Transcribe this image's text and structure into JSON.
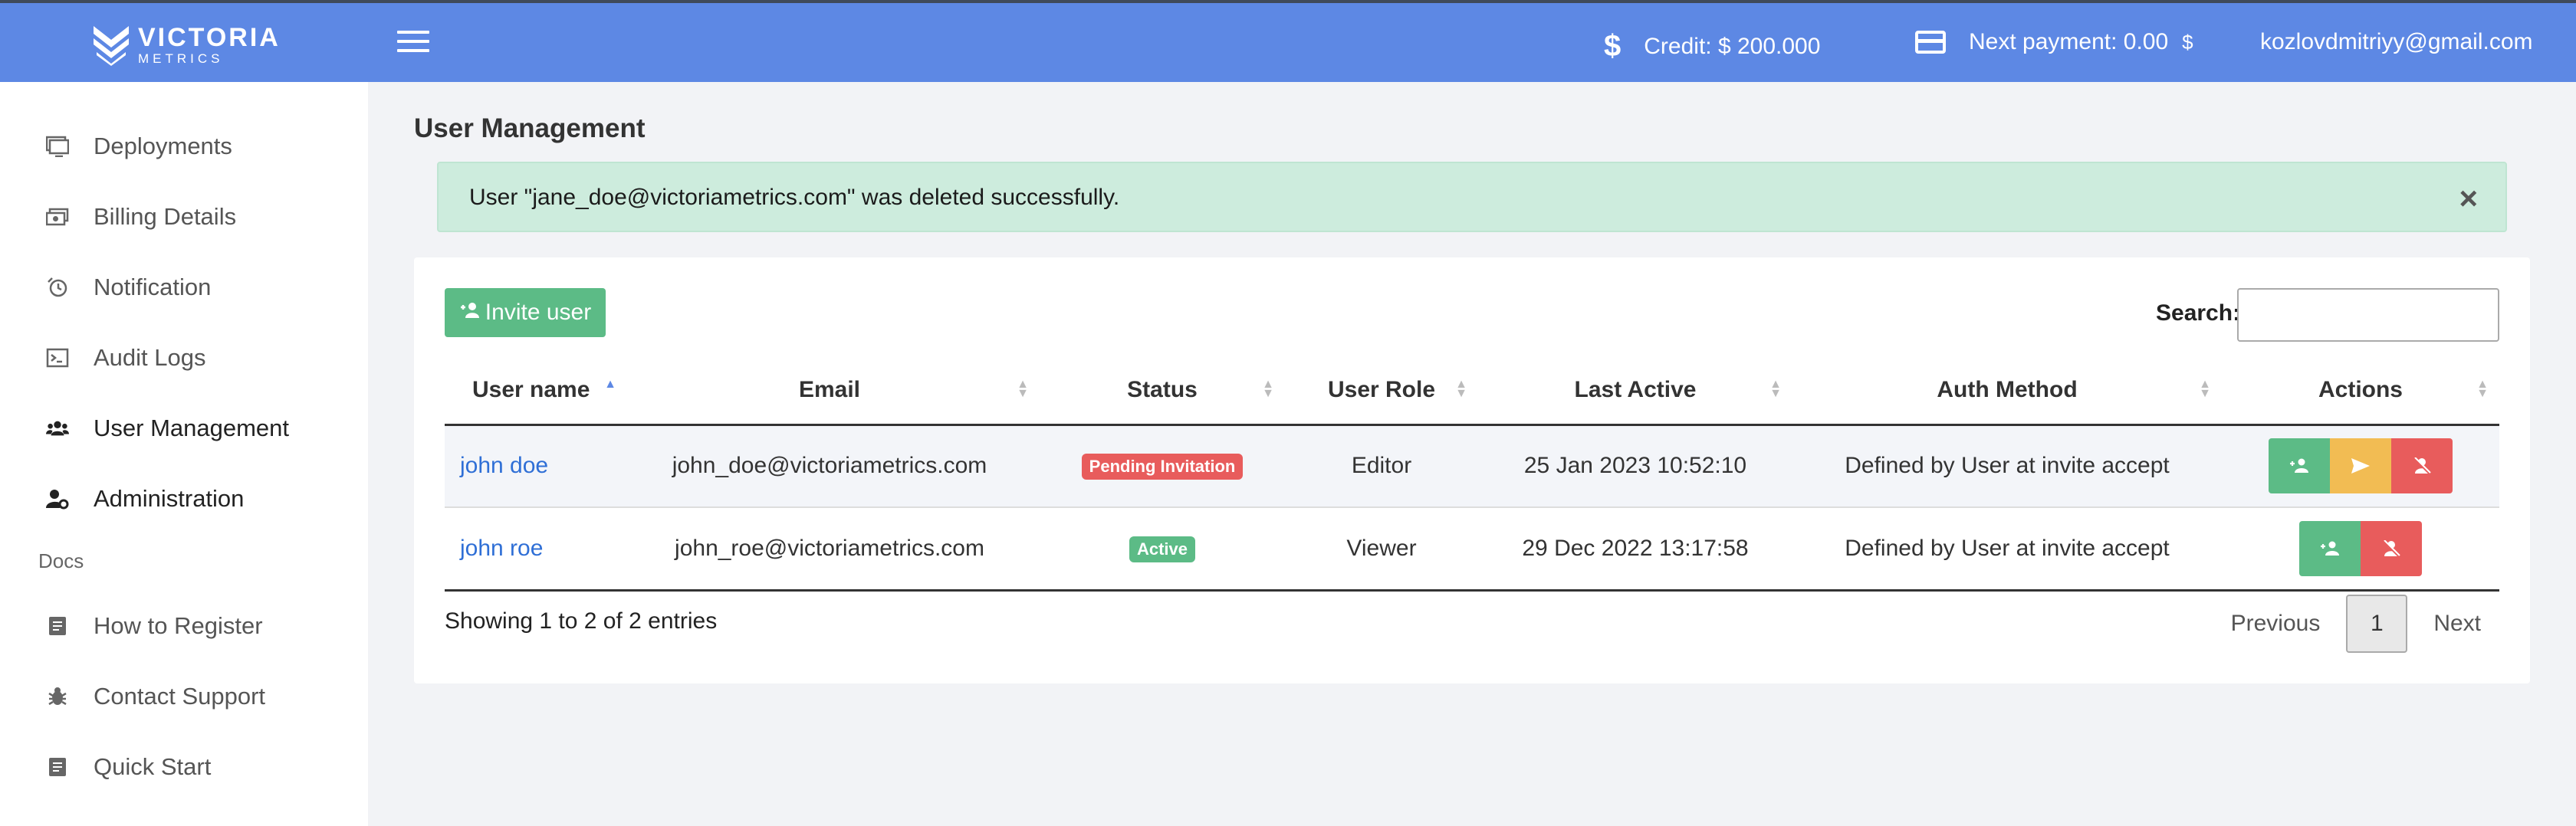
{
  "topbar": {
    "logo_line1": "VICTORIA",
    "logo_line2": "METRICS",
    "credit": "Credit: $ 200.000",
    "next_payment": "Next payment: 0.00",
    "next_payment_currency": "$",
    "user_email": "kozlovdmitriyy@gmail.com",
    "bar_color": "#5d88e4"
  },
  "sidebar": {
    "items": [
      {
        "label": "Deployments",
        "icon": "monitor-icon"
      },
      {
        "label": "Billing Details",
        "icon": "money-icon"
      },
      {
        "label": "Notification",
        "icon": "alarm-clock-icon"
      },
      {
        "label": "Audit Logs",
        "icon": "terminal-icon"
      },
      {
        "label": "User Management",
        "icon": "users-icon"
      },
      {
        "label": "Administration",
        "icon": "user-gear-icon"
      }
    ],
    "docs_label": "Docs",
    "docs_items": [
      {
        "label": "How to Register",
        "icon": "document-icon"
      },
      {
        "label": "Contact Support",
        "icon": "bug-icon"
      },
      {
        "label": "Quick Start",
        "icon": "document-icon"
      }
    ]
  },
  "page": {
    "title": "User Management",
    "alert_message": "User \"jane_doe@victoriametrics.com\" was deleted successfully.",
    "alert_close": "×"
  },
  "toolbar": {
    "invite_label": "Invite user",
    "search_label": "Search:",
    "search_value": ""
  },
  "table": {
    "columns": [
      "User name",
      "Email",
      "Status",
      "User Role",
      "Last Active",
      "Auth Method",
      "Actions"
    ],
    "sorted_column": "User name",
    "rows": [
      {
        "name": "john doe",
        "email": "john_doe@victoriametrics.com",
        "status": "Pending Invitation",
        "role": "Editor",
        "last_active": "25 Jan 2023 10:52:10",
        "auth": "Defined by User at invite accept"
      },
      {
        "name": "john roe",
        "email": "john_roe@victoriametrics.com",
        "status": "Active",
        "role": "Viewer",
        "last_active": "29 Dec 2022 13:17:58",
        "auth": "Defined by User at invite accept"
      }
    ]
  },
  "footer": {
    "showing": "Showing 1 to 2 of 2 entries",
    "previous": "Previous",
    "current_page": "1",
    "next": "Next"
  },
  "colors": {
    "success": "#5cbb86",
    "warning": "#f2bc53",
    "danger": "#e85c5c",
    "link": "#2f6fd6"
  }
}
